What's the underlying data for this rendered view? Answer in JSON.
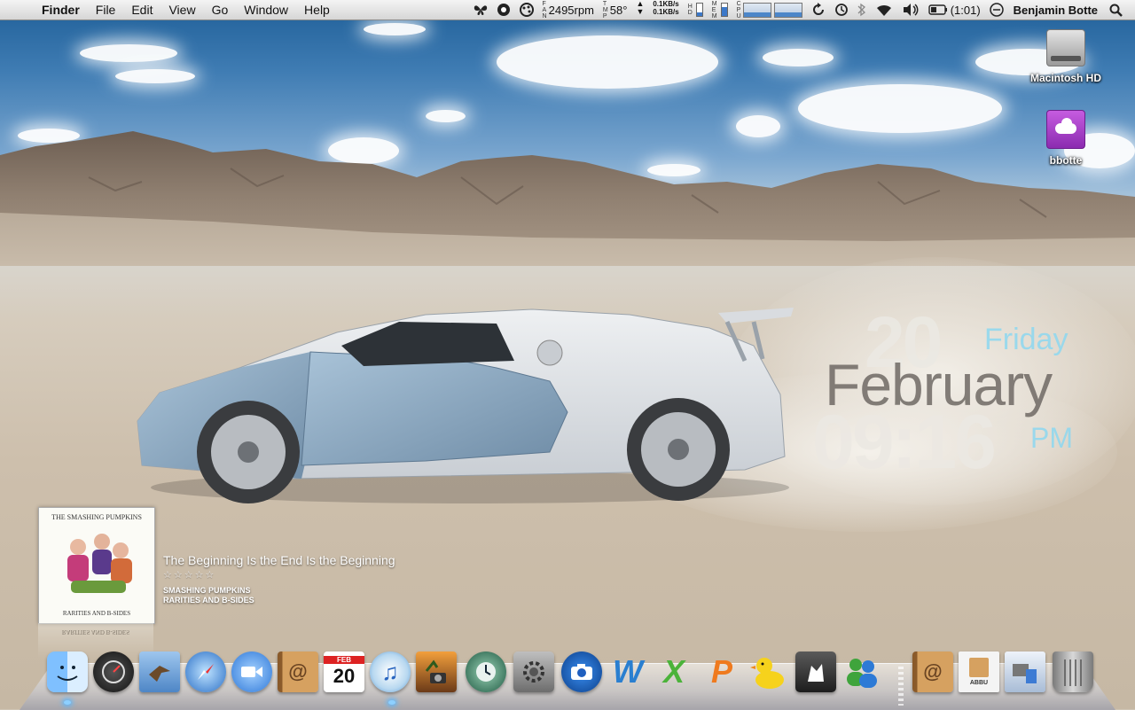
{
  "menubar": {
    "apple_glyph": "",
    "app_name": "Finder",
    "menus": [
      "File",
      "Edit",
      "View",
      "Go",
      "Window",
      "Help"
    ],
    "fan_label": [
      "F",
      "A",
      "N"
    ],
    "fan_speed": "2495rpm",
    "temp_label": [
      "T",
      "M",
      "P"
    ],
    "temp": "58°",
    "net_up": "0.1KB/s",
    "net_down": "0.1KB/s",
    "hd_label": [
      "H",
      "D"
    ],
    "mem_label": [
      "M",
      "E",
      "M"
    ],
    "cpu_label": [
      "C",
      "P",
      "U"
    ],
    "hd_level": 0.3,
    "mem_level": 0.7,
    "battery_time": "(1:01)",
    "user_name": "Benjamin Botte",
    "icons": [
      "butterfly-icon",
      "growl-icon",
      "color-wheel-icon",
      "sync-icon",
      "time-machine-icon",
      "bluetooth-icon",
      "wifi-icon",
      "volume-icon",
      "battery-icon",
      "fast-user-icon",
      "spotlight-icon"
    ]
  },
  "desktop": {
    "icons": [
      {
        "label": "Macintosh HD",
        "icon": "hard-drive-icon"
      },
      {
        "label": "bbotte",
        "icon": "idisk-icon"
      }
    ]
  },
  "clock": {
    "day": "20",
    "weekday": "Friday",
    "month": "February",
    "time": "09:16",
    "ampm": "PM"
  },
  "now_playing": {
    "album_band": "THE SMASHING PUMPKINS",
    "album_name": "RARITIES AND B-SIDES",
    "track_title": "The Beginning Is the End Is the Beginning",
    "rating_stars": "☆☆☆☆☆",
    "artist": "SMASHING PUMPKINS",
    "album": "RARITIES AND B-SIDES"
  },
  "dock": {
    "ical_month": "FEB",
    "ical_day": "20",
    "abbu_label": "ABBU",
    "items": [
      "finder",
      "dashboard",
      "mail-hawk",
      "safari",
      "ichat",
      "address-book",
      "ical",
      "itunes",
      "iphoto",
      "time-machine",
      "system-preferences",
      "photo-booth",
      "word",
      "excel",
      "powerpoint",
      "cyberduck",
      "kismac",
      "messenger",
      "address-book-folder",
      "abbu",
      "preview-docs",
      "trash"
    ]
  }
}
